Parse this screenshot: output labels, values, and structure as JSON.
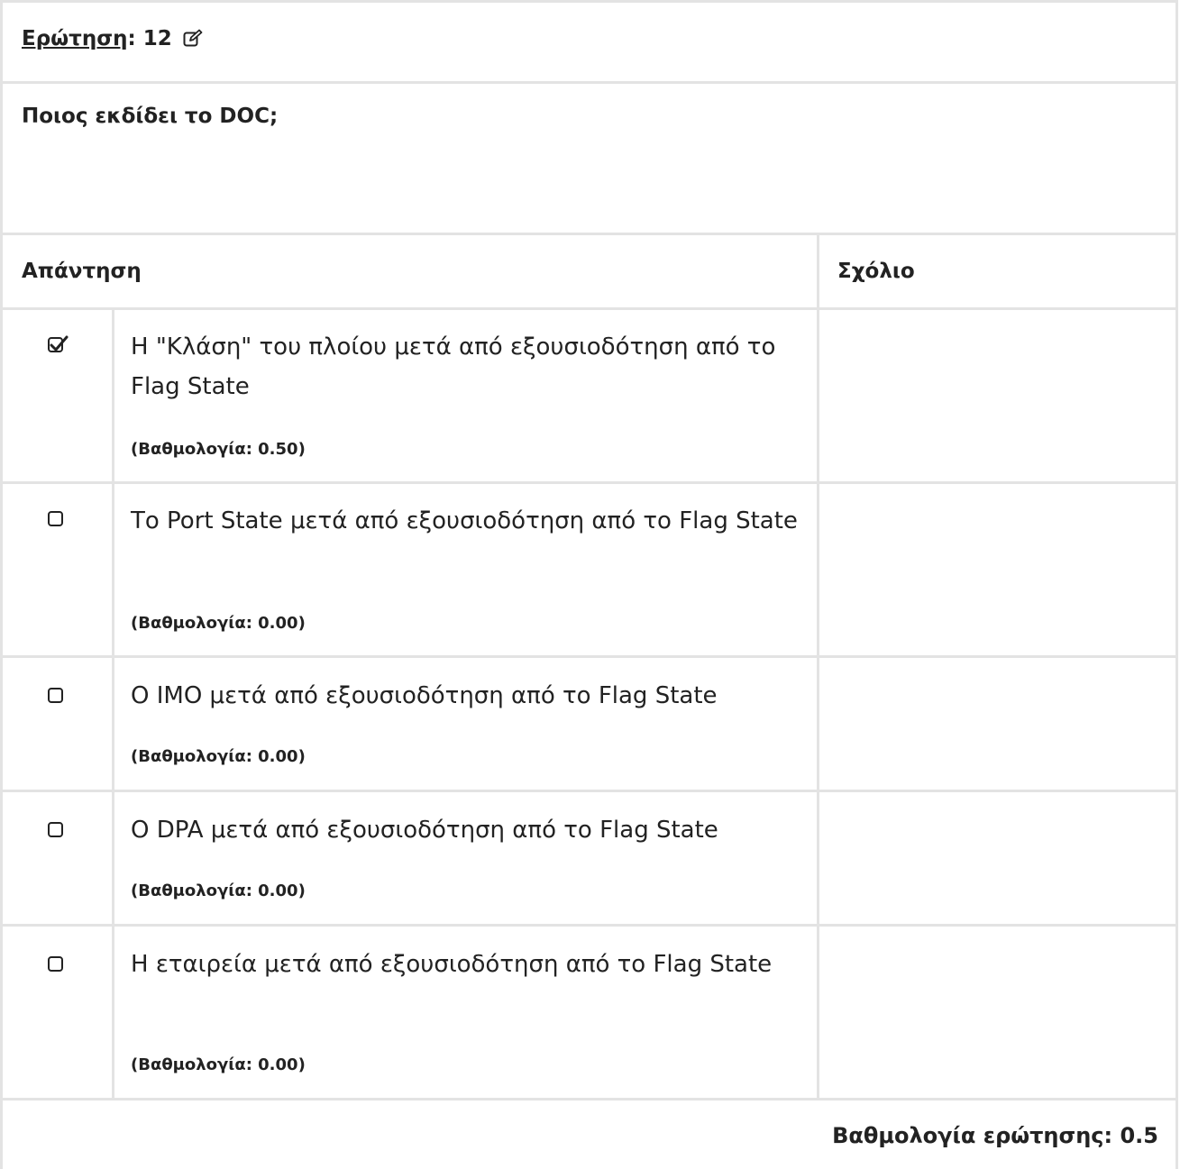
{
  "question": {
    "label": "Ερώτηση",
    "number_text": ": 12",
    "edit_icon": "edit-icon",
    "text": "Ποιος εκδίδει το DOC;"
  },
  "table": {
    "answer_header": "Απάντηση",
    "comment_header": "Σχόλιο",
    "answers": [
      {
        "checked": true,
        "text": "Η \"Κλάση\" του πλοίου μετά από εξουσιοδότηση από το Flag State",
        "score": "(Βαθμολογία: 0.50)",
        "comment": ""
      },
      {
        "checked": false,
        "text": "Το Port State μετά από εξουσιοδότηση από το Flag State",
        "score": "(Βαθμολογία: 0.00)",
        "comment": ""
      },
      {
        "checked": false,
        "text": "Ο IMO μετά από εξουσιοδότηση από το Flag State",
        "score": "(Βαθμολογία: 0.00)",
        "comment": ""
      },
      {
        "checked": false,
        "text": "Ο DPA μετά από εξουσιοδότηση από το Flag State",
        "score": "(Βαθμολογία: 0.00)",
        "comment": ""
      },
      {
        "checked": false,
        "text": "Η εταιρεία μετά από εξουσιοδότηση από το Flag State",
        "score": "(Βαθμολογία: 0.00)",
        "comment": ""
      }
    ]
  },
  "footer": {
    "total_score": "Βαθμολογία ερώτησης: 0.5"
  }
}
